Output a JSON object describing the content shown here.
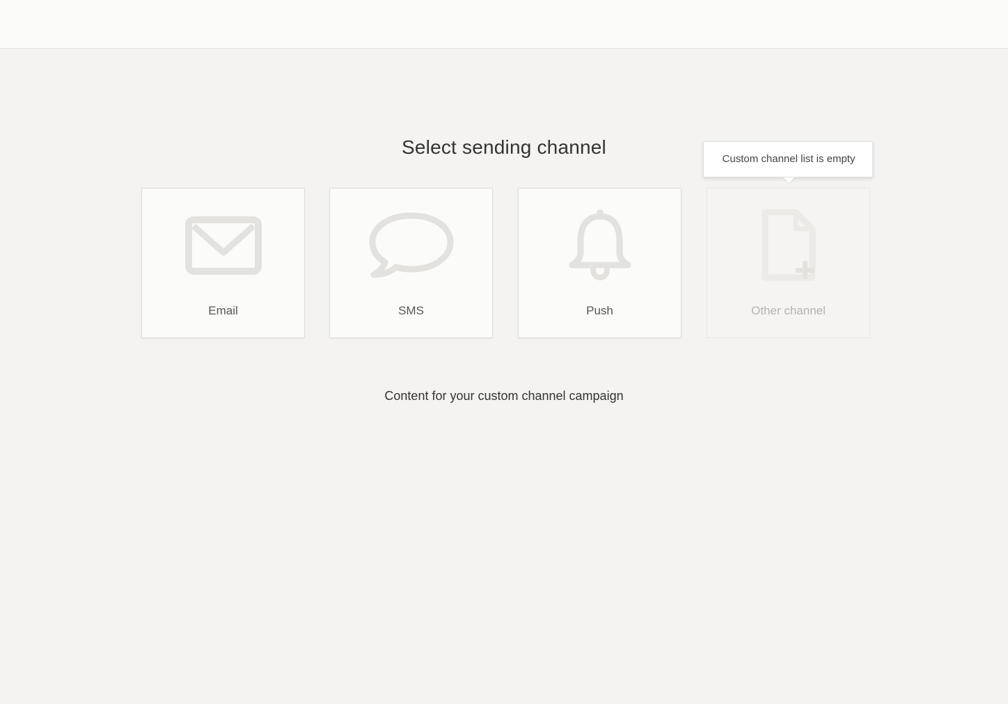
{
  "page": {
    "title": "Select sending channel",
    "subtext": "Content for your custom channel campaign"
  },
  "channels": [
    {
      "label": "Email",
      "icon": "envelope-icon",
      "enabled": true
    },
    {
      "label": "SMS",
      "icon": "speech-bubble-icon",
      "enabled": true
    },
    {
      "label": "Push",
      "icon": "bell-icon",
      "enabled": true
    },
    {
      "label": "Other channel",
      "icon": "document-plus-icon",
      "enabled": false
    }
  ],
  "tooltip": {
    "text": "Custom channel list is empty"
  },
  "colors": {
    "background": "#f4f3f1",
    "topbar": "#fbfbf9",
    "card": "#fbfbf9",
    "icon": "#e3e2df",
    "icon_disabled": "#eceae7"
  }
}
